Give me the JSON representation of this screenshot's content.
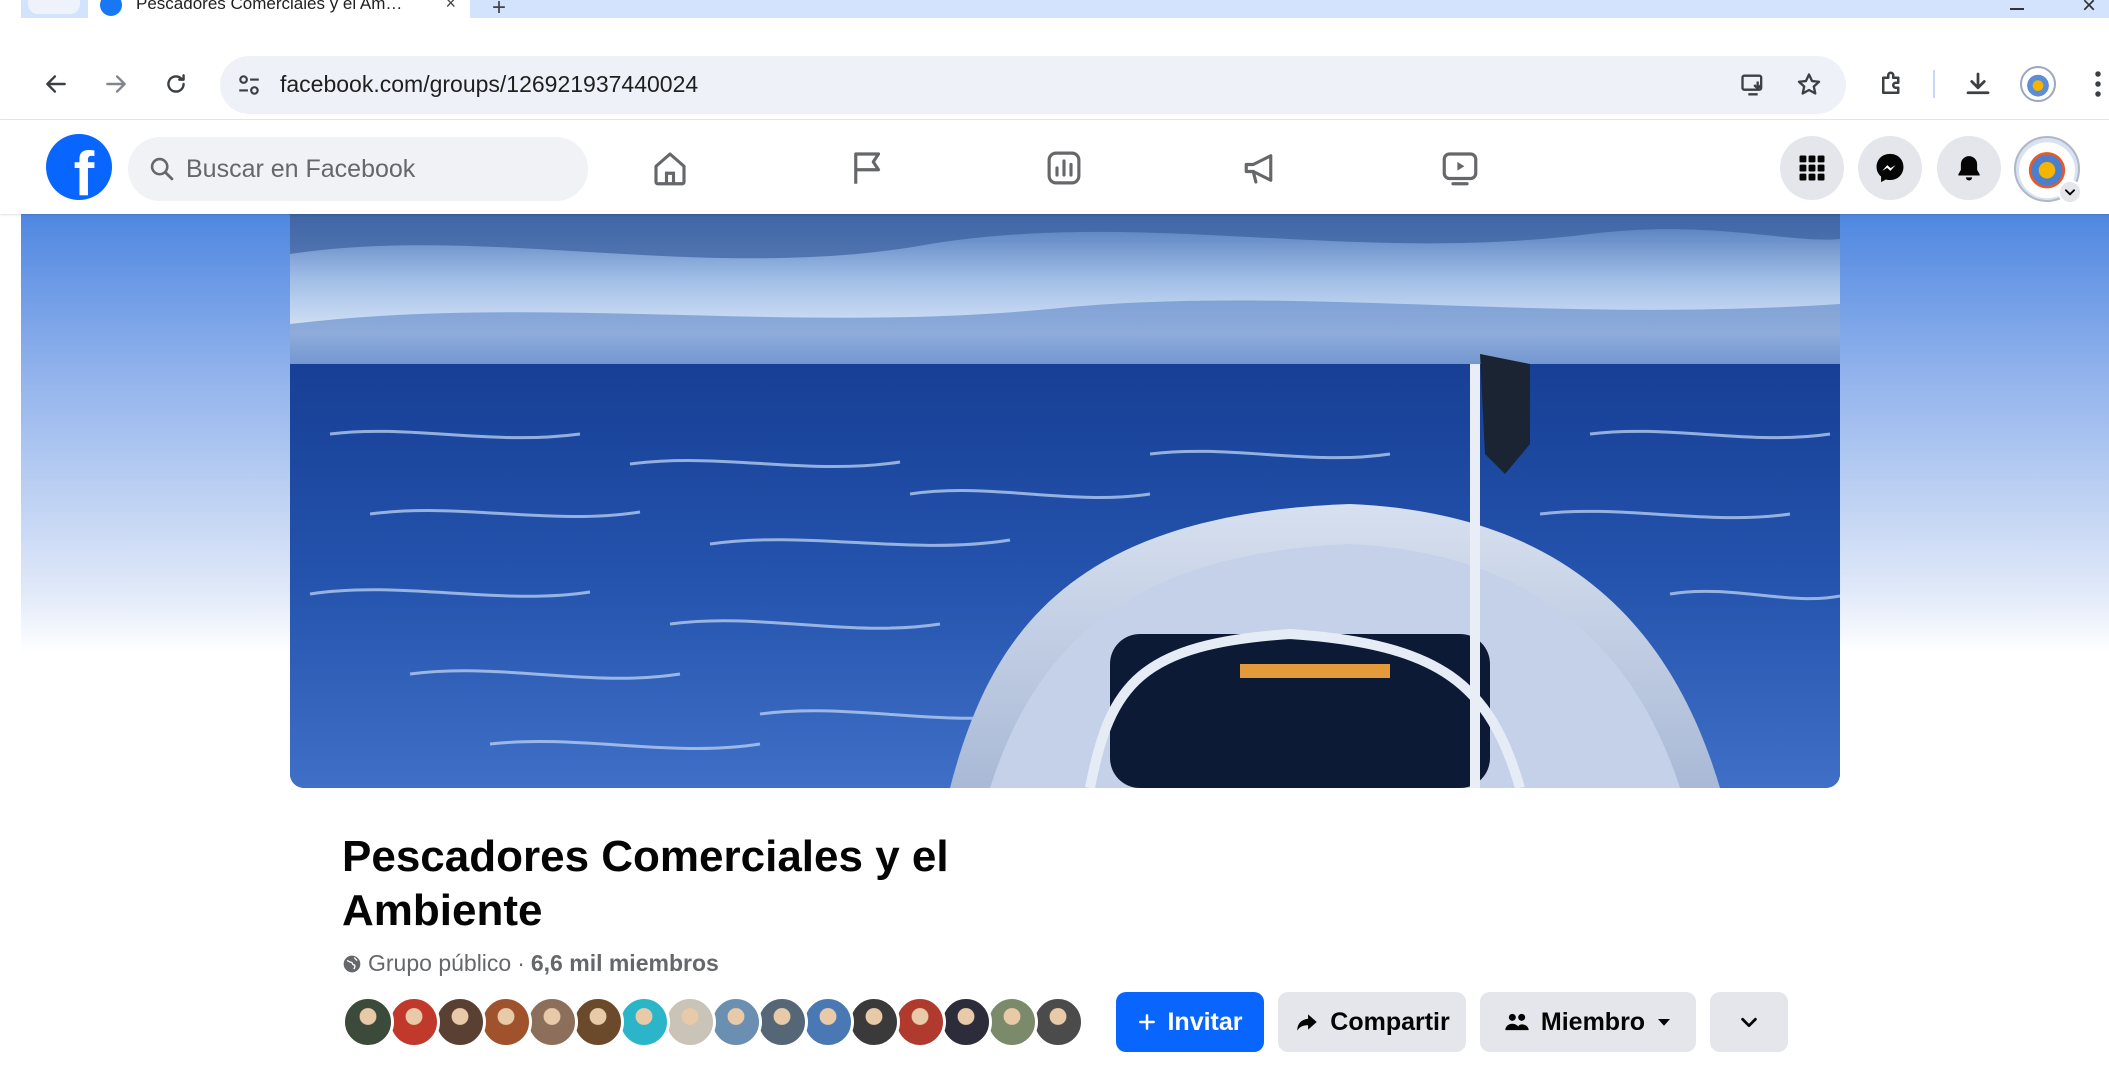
{
  "browser": {
    "tab_title": "Pescadores Comerciales y el Am…",
    "tab_close": "×",
    "new_tab": "+",
    "window_close": "×",
    "url": "facebook.com/groups/126921937440024"
  },
  "facebook": {
    "logo": "f",
    "search_placeholder": "Buscar en Facebook",
    "nav_icons": [
      "home-icon",
      "flag-icon",
      "insights-icon",
      "megaphone-icon",
      "video-icon"
    ],
    "right_icons": [
      "menu-grid-icon",
      "messenger-icon",
      "notifications-icon"
    ],
    "brand_color": "#0866ff"
  },
  "group": {
    "name": "Pescadores Comerciales y el Ambiente",
    "privacy": "Grupo público",
    "separator": "·",
    "members": "6,6 mil miembros",
    "member_avatar_colors": [
      "#3b4a3a",
      "#c0392b",
      "#5a4032",
      "#a0522d",
      "#8b6f5a",
      "#6b4a2b",
      "#2bb5c9",
      "#c9c3b8",
      "#6a8fb0",
      "#556677",
      "#4a78b5",
      "#3a3a3a",
      "#b03a2e",
      "#2c2c3a",
      "#7a8a6a",
      "#4b4b4b"
    ]
  },
  "actions": {
    "invite": "Invitar",
    "share": "Compartir",
    "member": "Miembro",
    "more": "more"
  }
}
